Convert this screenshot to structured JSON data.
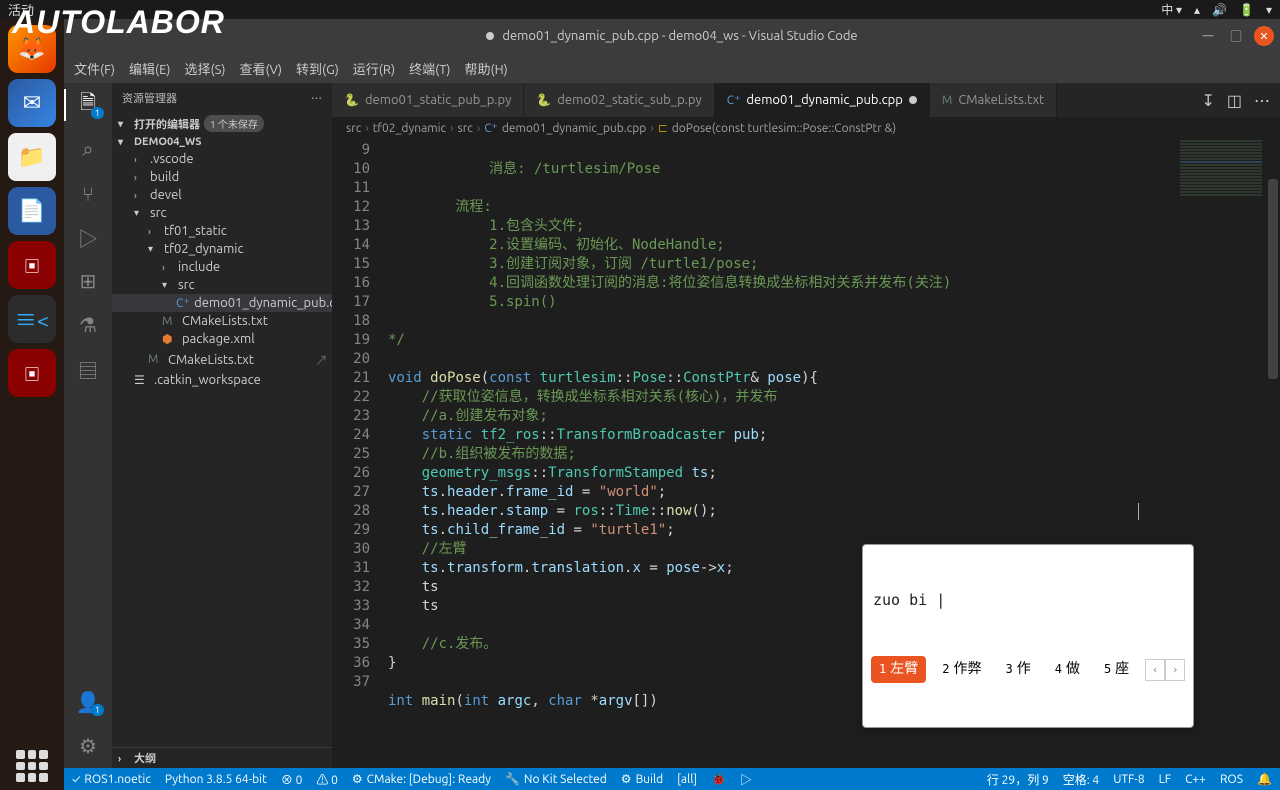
{
  "topbar": {
    "activities": "活动",
    "app_hint": "Visual Studio Code",
    "ime_indicator": "中 ▾"
  },
  "logo": "AUTOLABOR",
  "vscode_title": "demo01_dynamic_pub.cpp - demo04_ws - Visual Studio Code",
  "menu": [
    "文件(F)",
    "编辑(E)",
    "选择(S)",
    "查看(V)",
    "转到(G)",
    "运行(R)",
    "终端(T)",
    "帮助(H)"
  ],
  "sidebar": {
    "title": "资源管理器",
    "opened_editors": "打开的编辑器",
    "unsaved": "1 个未保存",
    "workspace": "DEMO04_WS",
    "tree": {
      "vscode": ".vscode",
      "build": "build",
      "devel": "devel",
      "src": "src",
      "tf01": "tf01_static",
      "tf02": "tf02_dynamic",
      "include": "include",
      "inner_src": "src",
      "file_cpp": "demo01_dynamic_pub.cpp",
      "cml1": "CMakeLists.txt",
      "pkg": "package.xml",
      "cml2": "CMakeLists.txt",
      "catkin": ".catkin_workspace"
    },
    "outline": "大纲"
  },
  "tabs": {
    "t1": "demo01_static_pub_p.py",
    "t2": "demo02_static_sub_p.py",
    "t3": "demo01_dynamic_pub.cpp",
    "t4": "CMakeLists.txt"
  },
  "breadcrumb": {
    "p1": "src",
    "p2": "tf02_dynamic",
    "p3": "src",
    "p4": "demo01_dynamic_pub.cpp",
    "p5": "doPose(const turtlesim::Pose::ConstPtr &)"
  },
  "line_numbers": [
    9,
    10,
    11,
    12,
    13,
    14,
    15,
    16,
    17,
    18,
    19,
    20,
    21,
    22,
    23,
    24,
    25,
    26,
    27,
    28,
    29,
    30,
    31,
    32,
    33,
    34,
    35,
    36,
    37
  ],
  "code": {
    "l9": "            消息: /turtlesim/Pose",
    "l10": "",
    "l11": "        流程:",
    "l12": "            1.包含头文件;",
    "l13": "            2.设置编码、初始化、NodeHandle;",
    "l14": "            3.创建订阅对象，订阅 /turtle1/pose;",
    "l15": "            4.回调函数处理订阅的消息:将位姿信息转换成坐标相对关系并发布(关注)",
    "l16": "            5.spin()",
    "l17": "",
    "l18": "*/",
    "l19": "",
    "l20a": "void",
    "l20b": "doPose",
    "l20c": "const",
    "l20d": "turtlesim",
    "l20e": "Pose",
    "l20f": "ConstPtr",
    "l20g": "pose",
    "l21": "    //获取位姿信息，转换成坐标系相对关系(核心)，并发布",
    "l22": "    //a.创建发布对象;",
    "l23a": "static",
    "l23b": "tf2_ros",
    "l23c": "TransformBroadcaster",
    "l23d": "pub",
    "l24": "    //b.组织被发布的数据;",
    "l25a": "geometry_msgs",
    "l25b": "TransformStamped",
    "l25c": "ts",
    "l26a": "ts",
    "l26b": "header",
    "l26c": "frame_id",
    "l26d": "\"world\"",
    "l27a": "ts",
    "l27b": "header",
    "l27c": "stamp",
    "l27d": "ros",
    "l27e": "Time",
    "l27f": "now",
    "l28a": "ts",
    "l28b": "child_frame_id",
    "l28c": "\"turtle1\"",
    "l29": "    //左臂",
    "l30a": "ts",
    "l30b": "transform",
    "l30c": "translation",
    "l30d": "x",
    "l30e": "pose",
    "l30f": "x",
    "l31": "    ts",
    "l32": "    ts",
    "l33": "",
    "l34": "    //c.发布。",
    "l35": "}",
    "l36": "",
    "l37a": "int",
    "l37b": "main",
    "l37c": "int",
    "l37d": "argc",
    "l37e": "char",
    "l37f": "argv"
  },
  "ime": {
    "input": "zuo bi |",
    "candidates": [
      {
        "n": "1",
        "t": "左臂"
      },
      {
        "n": "2",
        "t": "作弊"
      },
      {
        "n": "3",
        "t": "作"
      },
      {
        "n": "4",
        "t": "做"
      },
      {
        "n": "5",
        "t": "座"
      }
    ]
  },
  "statusbar": {
    "ros": "ROS1.noetic",
    "python": "Python 3.8.5 64-bit",
    "err": "⊗ 0",
    "warn": "⚠ 0",
    "cmake": "CMake: [Debug]: Ready",
    "kit": "No Kit Selected",
    "build": "Build",
    "all": "[all]",
    "pos": "行 29，列 9",
    "spaces": "空格: 4",
    "enc": "UTF-8",
    "eol": "LF",
    "lang": "C++",
    "ros2": "ROS",
    "bell": "🔔"
  }
}
